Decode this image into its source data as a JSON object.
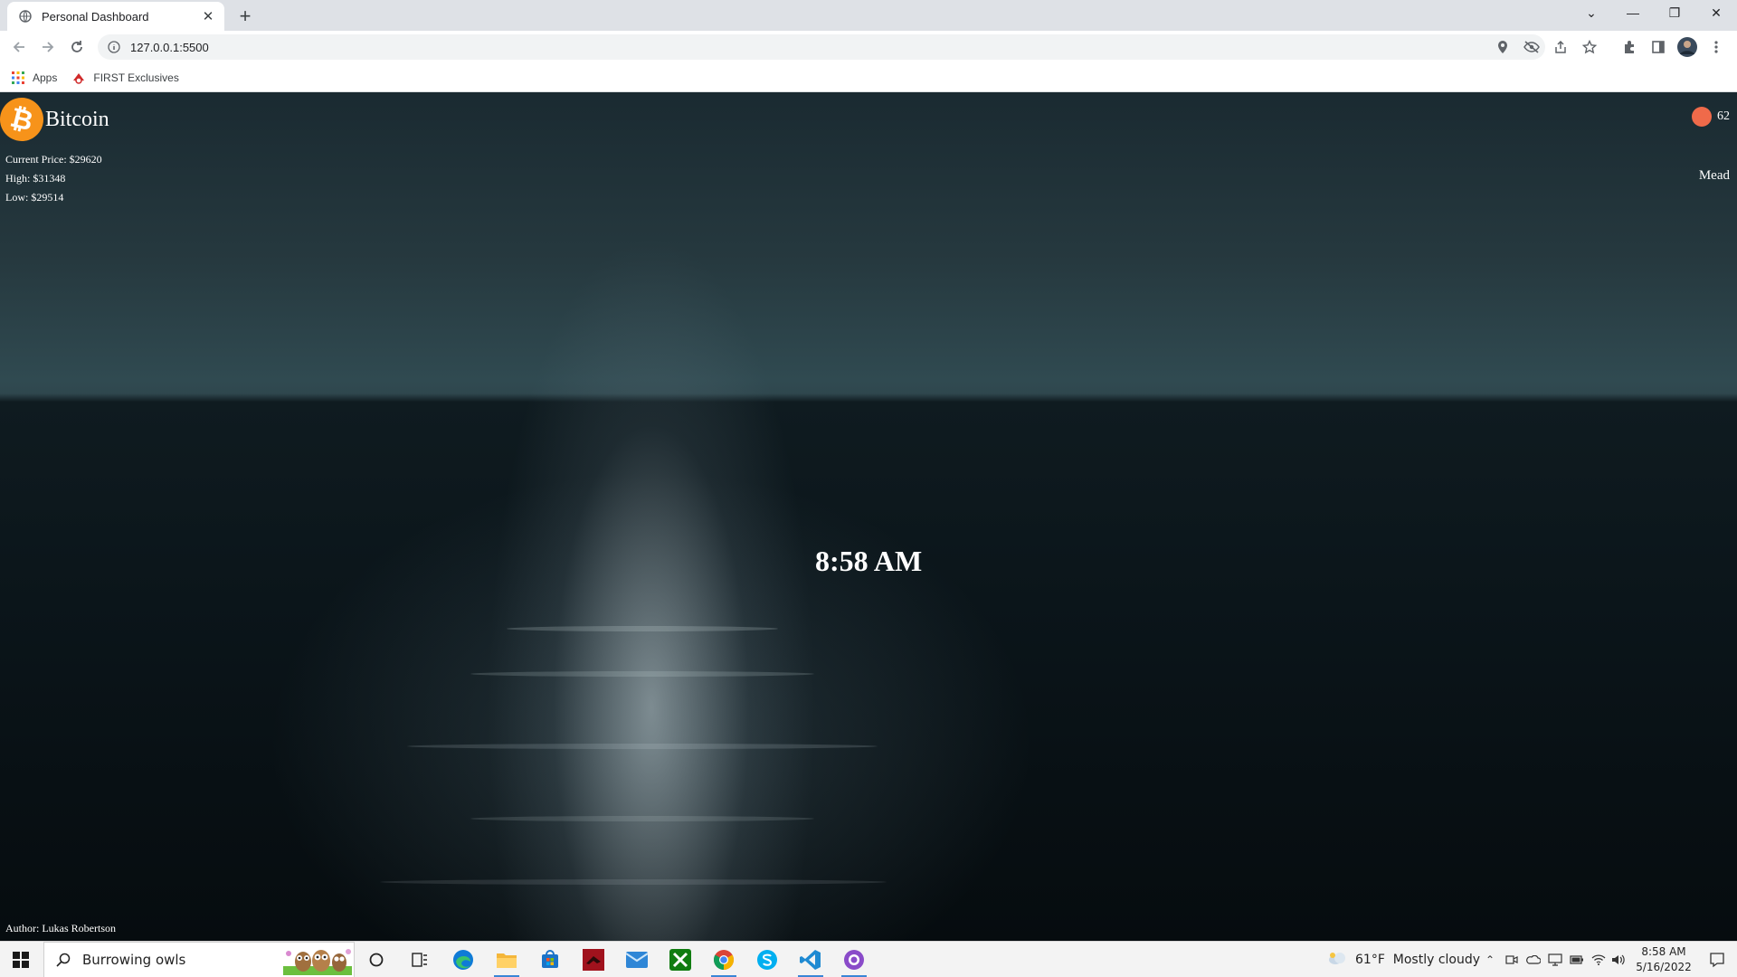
{
  "browser": {
    "tab_title": "Personal Dashboard",
    "new_tab": "+",
    "url": "127.0.0.1:5500",
    "bookmarks": [
      {
        "label": "Apps",
        "icon": "apps-grid-icon"
      },
      {
        "label": "FIRST Exclusives",
        "icon": "first-logo-icon"
      }
    ]
  },
  "dashboard": {
    "crypto": {
      "name": "Bitcoin",
      "current_price": "Current Price: $29620",
      "high": "High: $31348",
      "low": "Low: $29514",
      "logo_symbol": "₿",
      "logo_color": "#f7931a"
    },
    "weather": {
      "temperature": "62",
      "city": "Mead",
      "icon": "weather-sun-icon",
      "icon_color": "#ef6a4a"
    },
    "time": "8:58 AM",
    "author": "Author: Lukas Robertson"
  },
  "taskbar": {
    "search_text": "Burrowing owls",
    "weather": "61°F  Mostly cloudy",
    "clock_time": "8:58 AM",
    "clock_date": "5/16/2022",
    "apps": [
      "cortana-icon",
      "task-view-icon",
      "edge-icon",
      "file-explorer-icon",
      "store-icon",
      "red-app-icon",
      "mail-icon",
      "xbox-icon",
      "chrome-icon",
      "skype-icon",
      "vscode-icon",
      "github-desktop-icon"
    ]
  }
}
